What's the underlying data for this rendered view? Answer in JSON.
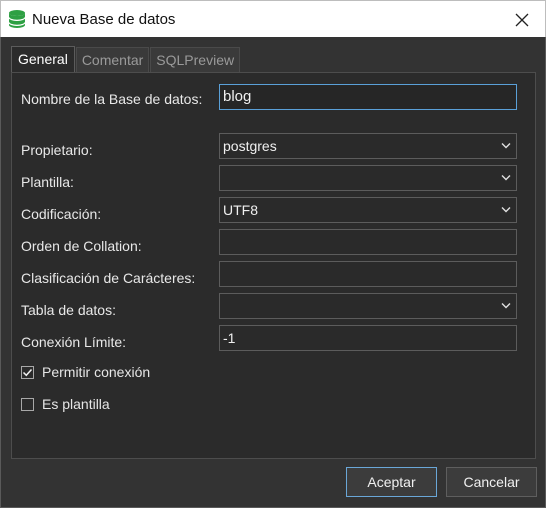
{
  "window": {
    "title": "Nueva Base de datos",
    "icon": "database-icon"
  },
  "tabs": [
    {
      "label": "General",
      "active": true
    },
    {
      "label": "Comentar",
      "active": false
    },
    {
      "label": "SQLPreview",
      "active": false
    }
  ],
  "form": {
    "name": {
      "label": "Nombre de la Base de datos:",
      "value": "blog"
    },
    "owner": {
      "label": "Propietario:",
      "value": "postgres"
    },
    "template": {
      "label": "Plantilla:",
      "value": ""
    },
    "encoding": {
      "label": "Codificación:",
      "value": "UTF8"
    },
    "collation": {
      "label": "Orden de Collation:",
      "value": ""
    },
    "ctype": {
      "label": "Clasificación de Carácteres:",
      "value": ""
    },
    "tablespace": {
      "label": "Tabla de datos:",
      "value": ""
    },
    "conn_limit": {
      "label": "Conexión Límite:",
      "value": "-1"
    },
    "allow_conn": {
      "label": "Permitir conexión",
      "checked": true
    },
    "is_template": {
      "label": "Es plantilla",
      "checked": false
    }
  },
  "buttons": {
    "accept": "Aceptar",
    "cancel": "Cancelar"
  },
  "colors": {
    "accent": "#5aa0d8",
    "background": "#2b2b2b",
    "db_icon": "#2ea043"
  }
}
